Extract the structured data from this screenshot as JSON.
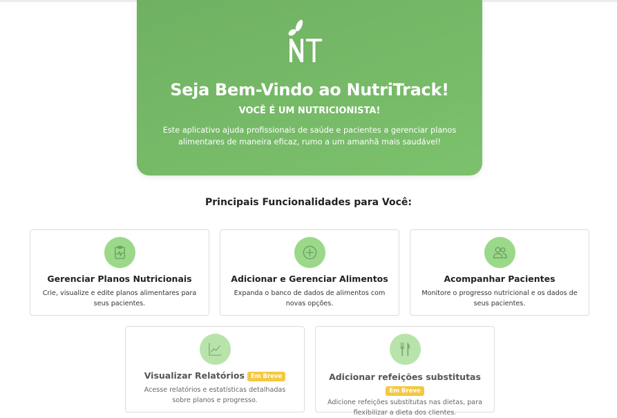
{
  "hero": {
    "title": "Seja Bem-Vindo ao NutriTrack!",
    "subtitle": "VOCÊ É UM NUTRICIONISTA!",
    "description": "Este aplicativo ajuda profissionais de saúde e pacientes a gerenciar planos alimentares de maneira eficaz, rumo a um amanhã mais saudável!",
    "logo_text": "NT"
  },
  "section": {
    "title": "Principais Funcionalidades para Você:"
  },
  "cards": [
    {
      "title": "Gerenciar Planos Nutricionais",
      "description": "Crie, visualize e edite planos alimentares para seus pacientes.",
      "icon": "clipboard-pulse-icon"
    },
    {
      "title": "Adicionar e Gerenciar Alimentos",
      "description": "Expanda o banco de dados de alimentos com novas opções.",
      "icon": "plus-circle-icon"
    },
    {
      "title": "Acompanhar Pacientes",
      "description": "Monitore o progresso nutricional e os dados de seus pacientes.",
      "icon": "users-icon"
    },
    {
      "title": "Visualizar Relatórios",
      "badge": "Em Breve",
      "description": "Acesse relatórios e estatísticas detalhadas sobre planos e progresso.",
      "icon": "chart-line-icon"
    },
    {
      "title": "Adicionar refeições substitutas",
      "badge": "Em Breve",
      "description": "Adicione refeições substitutas nas dietas, para flexibilizar a dieta dos clientes.",
      "icon": "utensils-icon"
    }
  ],
  "colors": {
    "brand_green": "#7cc16c",
    "icon_green": "#9bd88a",
    "badge_yellow": "#f5c842"
  }
}
